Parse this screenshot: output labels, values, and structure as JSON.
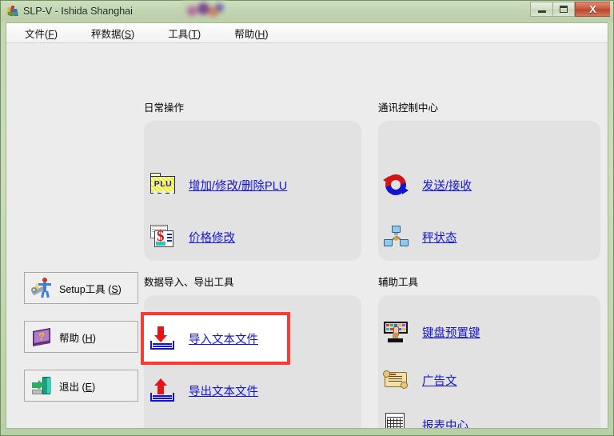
{
  "window": {
    "title": "SLP-V - Ishida Shanghai",
    "app_icon": "app-icon",
    "controls": {
      "minimize": "minimize-button",
      "maximize": "maximize-button",
      "close": "X"
    }
  },
  "menubar": {
    "items": [
      {
        "label": "文件(F)",
        "text": "文件",
        "accel": "F"
      },
      {
        "label": "秤数据(S)",
        "text": "秤数据",
        "accel": "S"
      },
      {
        "label": "工具(T)",
        "text": "工具",
        "accel": "T"
      },
      {
        "label": "帮助(H)",
        "text": "帮助",
        "accel": "H"
      }
    ]
  },
  "sidebar": {
    "buttons": [
      {
        "label": "Setup工具 (S)",
        "text": "Setup工具 ",
        "accel": "S",
        "icon": "setup-tool-icon"
      },
      {
        "label": "帮助 (H)",
        "text": "帮助 ",
        "accel": "H",
        "icon": "help-book-icon"
      },
      {
        "label": "退出 (E)",
        "text": "退出 ",
        "accel": "E",
        "icon": "exit-door-icon"
      }
    ]
  },
  "sections": {
    "daily_operations": {
      "label": "日常操作",
      "links": [
        {
          "label": "增加/修改/删除PLU",
          "icon": "plu-folder-icon"
        },
        {
          "label": "价格修改",
          "icon": "price-tag-icon"
        }
      ]
    },
    "communication_center": {
      "label": "通讯控制中心",
      "links": [
        {
          "label": "发送/接收",
          "icon": "sync-arrows-icon"
        },
        {
          "label": "秤状态",
          "icon": "scale-network-icon"
        }
      ]
    },
    "data_import_export": {
      "label": "数据导入、导出工具",
      "links": [
        {
          "label": "导入文本文件",
          "icon": "import-file-icon",
          "highlighted": true
        },
        {
          "label": "导出文本文件",
          "icon": "export-file-icon",
          "highlighted": false
        }
      ]
    },
    "auxiliary_tools": {
      "label": "辅助工具",
      "links": [
        {
          "label": "键盘预置键",
          "icon": "keyboard-preset-icon"
        },
        {
          "label": "广告文",
          "icon": "advert-scroll-icon"
        },
        {
          "label": "报表中心",
          "icon": "report-table-icon"
        }
      ]
    }
  },
  "colors": {
    "link": "#1414cc",
    "highlight_box": "#fc3a34",
    "panel_bg": "#e2e2e2",
    "client_bg": "#ececec",
    "titlebar": "#c6d7b6"
  }
}
